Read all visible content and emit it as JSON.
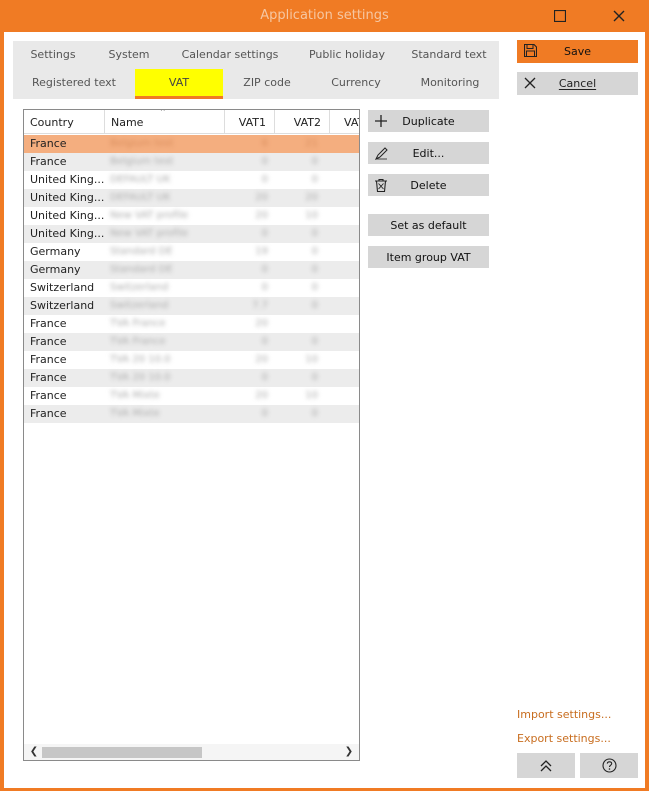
{
  "window": {
    "title": "Application settings"
  },
  "tabs": {
    "row1": [
      "Settings",
      "System",
      "Calendar settings",
      "Public holiday",
      "Standard text"
    ],
    "row2": [
      "Registered text",
      "VAT",
      "ZIP code",
      "Currency",
      "Monitoring"
    ],
    "active": "VAT"
  },
  "grid": {
    "columns": [
      "Country",
      "Name",
      "VAT1",
      "VAT2",
      "VAT"
    ],
    "rows": [
      {
        "country": "France",
        "name": "Belgium test",
        "vat1": "6",
        "vat2": "21"
      },
      {
        "country": "France",
        "name": "Belgium test",
        "vat1": "0",
        "vat2": "0"
      },
      {
        "country": "United King...",
        "name": "DEFAULT UK",
        "vat1": "0",
        "vat2": "0"
      },
      {
        "country": "United King...",
        "name": "DEFAULT UK",
        "vat1": "20",
        "vat2": "20"
      },
      {
        "country": "United King...",
        "name": "New VAT profile",
        "vat1": "20",
        "vat2": "10"
      },
      {
        "country": "United King...",
        "name": "New VAT profile",
        "vat1": "0",
        "vat2": "0"
      },
      {
        "country": "Germany",
        "name": "Standard DE",
        "vat1": "19",
        "vat2": "0"
      },
      {
        "country": "Germany",
        "name": "Standard DE",
        "vat1": "0",
        "vat2": "0"
      },
      {
        "country": "Switzerland",
        "name": "Switzerland",
        "vat1": "0",
        "vat2": "0"
      },
      {
        "country": "Switzerland",
        "name": "Switzerland",
        "vat1": "7.7",
        "vat2": "0"
      },
      {
        "country": "France",
        "name": "TVA France",
        "vat1": "20",
        "vat2": ""
      },
      {
        "country": "France",
        "name": "TVA France",
        "vat1": "0",
        "vat2": "0"
      },
      {
        "country": "France",
        "name": "TVA 20 10.0",
        "vat1": "20",
        "vat2": "10"
      },
      {
        "country": "France",
        "name": "TVA 20 10.0",
        "vat1": "0",
        "vat2": "0"
      },
      {
        "country": "France",
        "name": "TVA Mixte",
        "vat1": "20",
        "vat2": "10"
      },
      {
        "country": "France",
        "name": "TVA Mixte",
        "vat1": "0",
        "vat2": "0"
      }
    ]
  },
  "actions": {
    "duplicate": "Duplicate",
    "edit": "Edit...",
    "delete": "Delete",
    "set_default": "Set as default",
    "item_group_vat": "Item group VAT"
  },
  "side": {
    "save": "Save",
    "cancel": "Cancel",
    "import": "Import settings...",
    "export": "Export settings..."
  },
  "colors": {
    "accent": "#f07b24",
    "active_tab": "#ffff00",
    "selected_row": "#f4ae7f",
    "button": "#d6d6d6"
  }
}
